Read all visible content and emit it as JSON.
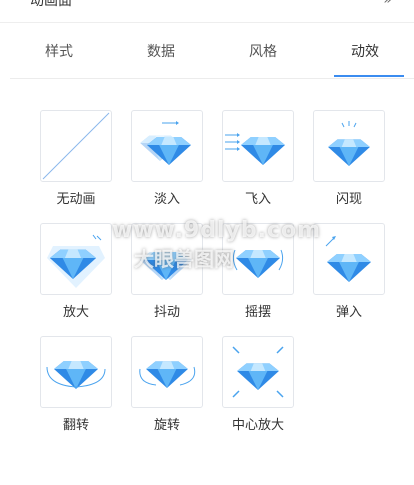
{
  "header": {
    "title": "动画面",
    "collapse_icon": "double-chevron-right-icon"
  },
  "tabs": [
    {
      "label": "样式",
      "active": false
    },
    {
      "label": "数据",
      "active": false
    },
    {
      "label": "风格",
      "active": false
    },
    {
      "label": "动效",
      "active": true
    }
  ],
  "effects": [
    {
      "label": "无动画",
      "icon": "no-animation-icon"
    },
    {
      "label": "淡入",
      "icon": "fade-in-icon"
    },
    {
      "label": "飞入",
      "icon": "fly-in-icon"
    },
    {
      "label": "闪现",
      "icon": "flash-icon"
    },
    {
      "label": "放大",
      "icon": "zoom-in-icon"
    },
    {
      "label": "抖动",
      "icon": "shake-icon"
    },
    {
      "label": "摇摆",
      "icon": "swing-icon"
    },
    {
      "label": "弹入",
      "icon": "bounce-in-icon"
    },
    {
      "label": "翻转",
      "icon": "flip-icon"
    },
    {
      "label": "旋转",
      "icon": "rotate-icon"
    },
    {
      "label": "中心放大",
      "icon": "center-zoom-icon"
    }
  ],
  "watermark": {
    "line1": "www.9dlyb.com",
    "line2": "大眼兽图网"
  },
  "colors": {
    "accent": "#3b8cf0",
    "gem_light": "#8fd0ff",
    "gem_dark": "#2f8ae6"
  }
}
